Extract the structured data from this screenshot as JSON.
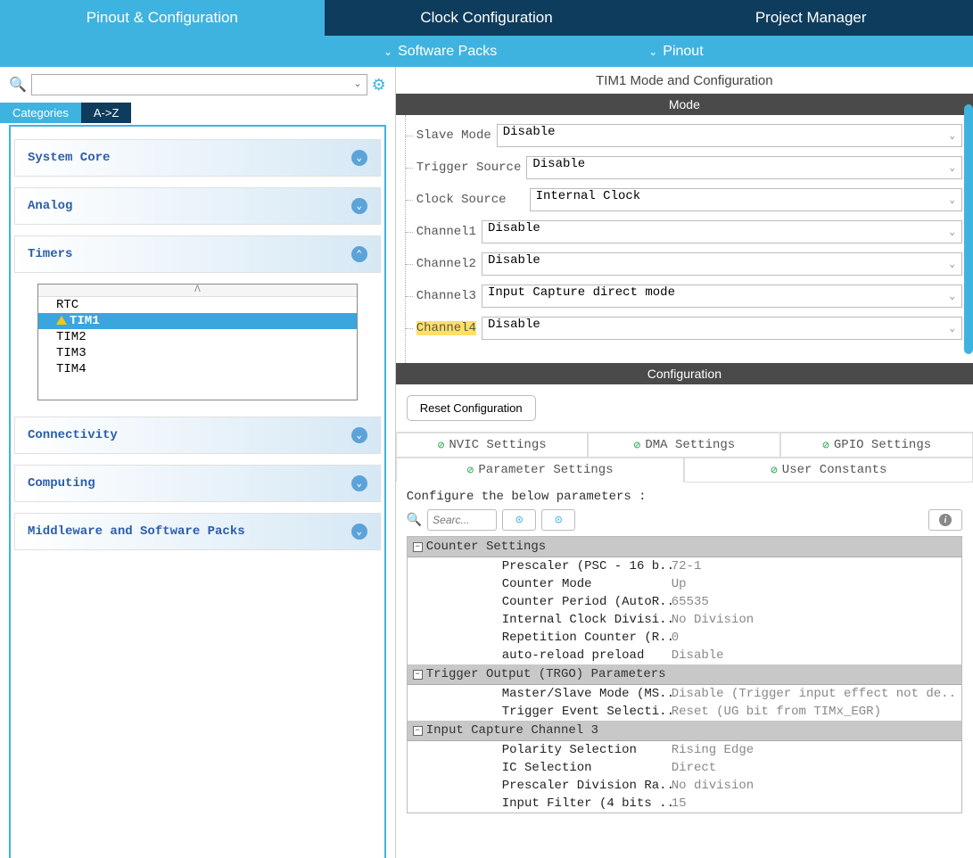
{
  "tabs": {
    "t1": "Pinout & Configuration",
    "t2": "Clock Configuration",
    "t3": "Project Manager"
  },
  "subbar": {
    "s1": "Software Packs",
    "s2": "Pinout"
  },
  "catTabs": {
    "c1": "Categories",
    "c2": "A->Z"
  },
  "accordion": {
    "a1": "System Core",
    "a2": "Analog",
    "a3": "Timers",
    "a4": "Connectivity",
    "a5": "Computing",
    "a6": "Middleware and Software Packs"
  },
  "timers": {
    "head": "ᐱ",
    "i0": "RTC",
    "i1": "TIM1",
    "i2": "TIM2",
    "i3": "TIM3",
    "i4": "TIM4"
  },
  "rightTitle": "TIM1 Mode and Configuration",
  "modeHeader": "Mode",
  "mode": {
    "l0": "Slave Mode",
    "v0": "Disable",
    "l1": "Trigger Source",
    "v1": "Disable",
    "l2": "Clock Source",
    "v2": "Internal Clock",
    "l3": "Channel1",
    "v3": "Disable",
    "l4": "Channel2",
    "v4": "Disable",
    "l5": "Channel3",
    "v5": "Input Capture direct mode",
    "l6": "Channel4",
    "v6": "Disable"
  },
  "configHeader": "Configuration",
  "resetBtn": "Reset Configuration",
  "cfgTabs": {
    "t0": "NVIC Settings",
    "t1": "DMA Settings",
    "t2": "GPIO Settings",
    "t3": "Parameter Settings",
    "t4": "User Constants"
  },
  "cfgPrompt": "Configure the below parameters :",
  "searchPh": "Searc...",
  "groups": {
    "g0": "Counter Settings",
    "g1": "Trigger Output (TRGO) Parameters",
    "g2": "Input Capture Channel 3"
  },
  "params": {
    "p0n": "Prescaler (PSC - 16 b..",
    "p0v": "72-1",
    "p1n": "Counter Mode",
    "p1v": "Up",
    "p2n": "Counter Period (AutoR..",
    "p2v": "65535",
    "p3n": "Internal Clock Divisi..",
    "p3v": "No Division",
    "p4n": "Repetition Counter (R..",
    "p4v": "0",
    "p5n": "auto-reload preload",
    "p5v": "Disable",
    "p6n": "Master/Slave Mode (MS..",
    "p6v": "Disable (Trigger input effect not de..",
    "p7n": "Trigger Event Selecti..",
    "p7v": "Reset (UG bit from TIMx_EGR)",
    "p8n": "Polarity Selection",
    "p8v": "Rising Edge",
    "p9n": "IC Selection",
    "p9v": "Direct",
    "p10n": "Prescaler Division Ra..",
    "p10v": "No division",
    "p11n": "Input Filter (4 bits ..",
    "p11v": "15"
  }
}
